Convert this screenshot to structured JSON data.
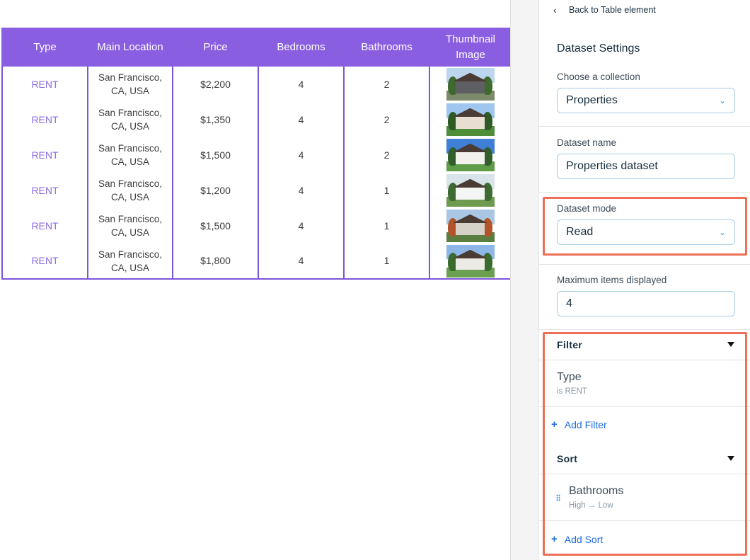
{
  "table": {
    "headers": [
      "Type",
      "Main Location",
      "Price",
      "Bedrooms",
      "Bathrooms",
      "Thumbnail Image"
    ],
    "rows": [
      {
        "type": "RENT",
        "location": "San Francisco, CA, USA",
        "price": "$2,200",
        "bedrooms": "4",
        "bathrooms": "2",
        "thumb": "house-photo-1"
      },
      {
        "type": "RENT",
        "location": "San Francisco, CA, USA",
        "price": "$1,350",
        "bedrooms": "4",
        "bathrooms": "2",
        "thumb": "house-photo-2"
      },
      {
        "type": "RENT",
        "location": "San Francisco, CA, USA",
        "price": "$1,500",
        "bedrooms": "4",
        "bathrooms": "2",
        "thumb": "house-photo-3"
      },
      {
        "type": "RENT",
        "location": "San Francisco, CA, USA",
        "price": "$1,200",
        "bedrooms": "4",
        "bathrooms": "1",
        "thumb": "house-photo-4"
      },
      {
        "type": "RENT",
        "location": "San Francisco, CA, USA",
        "price": "$1,500",
        "bedrooms": "4",
        "bathrooms": "1",
        "thumb": "house-photo-5"
      },
      {
        "type": "RENT",
        "location": "San Francisco, CA, USA",
        "price": "$1,800",
        "bedrooms": "4",
        "bathrooms": "1",
        "thumb": "house-photo-6"
      }
    ]
  },
  "panel": {
    "back_label": "Back to Table element",
    "back_icon": "chevron-left-icon",
    "title": "Dataset Settings",
    "collection_label": "Choose a collection",
    "collection_value": "Properties",
    "dataset_name_label": "Dataset name",
    "dataset_name_value": "Properties dataset",
    "mode_label": "Dataset mode",
    "mode_value": "Read",
    "max_items_label": "Maximum items displayed",
    "max_items_value": "4",
    "filter": {
      "title": "Filter",
      "item_title": "Type",
      "item_sub": "is RENT",
      "add_label": "Add Filter"
    },
    "sort": {
      "title": "Sort",
      "item_title": "Bathrooms",
      "item_sub": "High → Low",
      "add_label": "Add Sort"
    }
  },
  "colors": {
    "header_purple": "#8a5ee0",
    "highlight": "#ee6f57",
    "link_blue": "#1f6be0"
  }
}
